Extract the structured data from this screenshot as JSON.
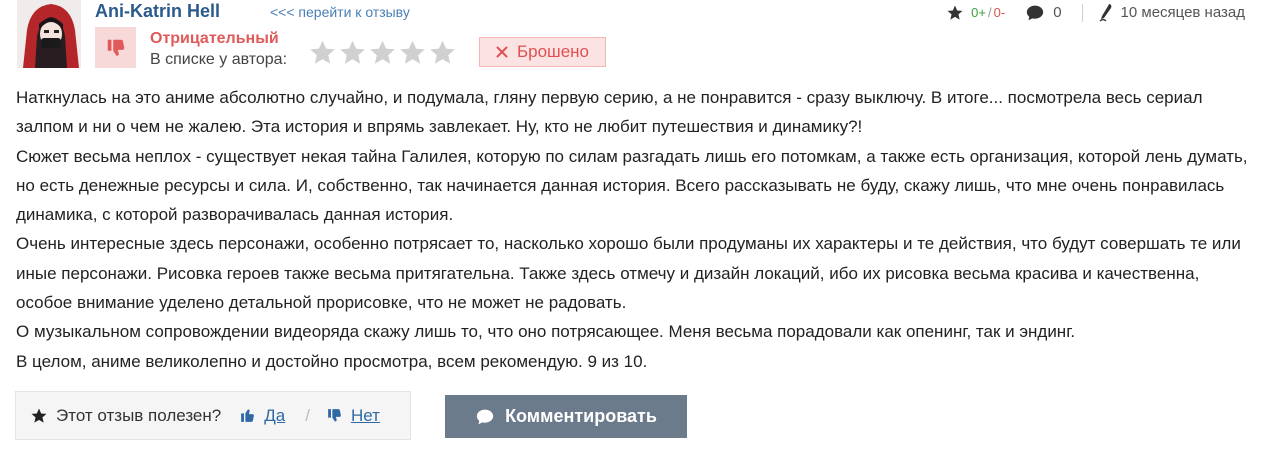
{
  "review": {
    "author": "Ani-Katrin Hell",
    "goto_link": "<<< перейти к отзыву",
    "rating_label": "Отрицательный",
    "in_list_label": "В списке у автора:",
    "stars_filled": 0,
    "stars_total": 5,
    "list_status": "Брошено",
    "meta": {
      "votes_plus": "0+",
      "votes_slash": "/",
      "votes_minus": "0-",
      "comments_count": "0",
      "time_ago": "10 месяцев назад"
    },
    "paragraphs": [
      "Наткнулась на это аниме абсолютно случайно, и подумала, гляну первую серию, а не понравится - сразу выключу. В итоге... посмотрела весь сериал залпом и ни о чем не жалею. Эта история и впрямь завлекает. Ну, кто не любит путешествия и динамику?!",
      "Сюжет весьма неплох - существует некая тайна Галилея, которую по силам разгадать лишь его потомкам, а также есть организация, которой лень думать, но есть денежные ресурсы и сила. И, собственно, так начинается данная история. Всего рассказывать не буду, скажу лишь, что мне очень понравилась динамика, с которой разворачивалась данная история.",
      "Очень интересные здесь персонажи, особенно потрясает то, насколько хорошо были продуманы их характеры и те действия, что будут совершать те или иные персонажи. Рисовка героев также весьма притягательна. Также здесь отмечу и дизайн локаций, ибо их рисовка весьма красива и качественна, особое внимание уделено детальной прорисовке, что не может не радовать.",
      "О музыкальном сопровождении видеоряда скажу лишь то, что оно потрясающее. Меня весьма порадовали как опенинг, так и эндинг.",
      "В целом, аниме великолепно и достойно просмотра, всем рекомендую. 9 из 10."
    ],
    "useful": {
      "question": "Этот отзыв полезен?",
      "yes": "Да",
      "separator": "/",
      "no": "Нет"
    },
    "comment_button": "Комментировать"
  },
  "icons": {
    "avatar": "avatar-image",
    "thumbs_down": "thumbs-down-icon",
    "star": "star-icon",
    "comment": "comment-icon",
    "pen": "pen-icon",
    "close": "close-icon",
    "thumbs_up": "thumbs-up-icon"
  },
  "colors": {
    "author": "#2b5a8c",
    "negative": "#e05a5a",
    "button": "#6c7b8c",
    "star_empty": "#d0d0d0"
  }
}
